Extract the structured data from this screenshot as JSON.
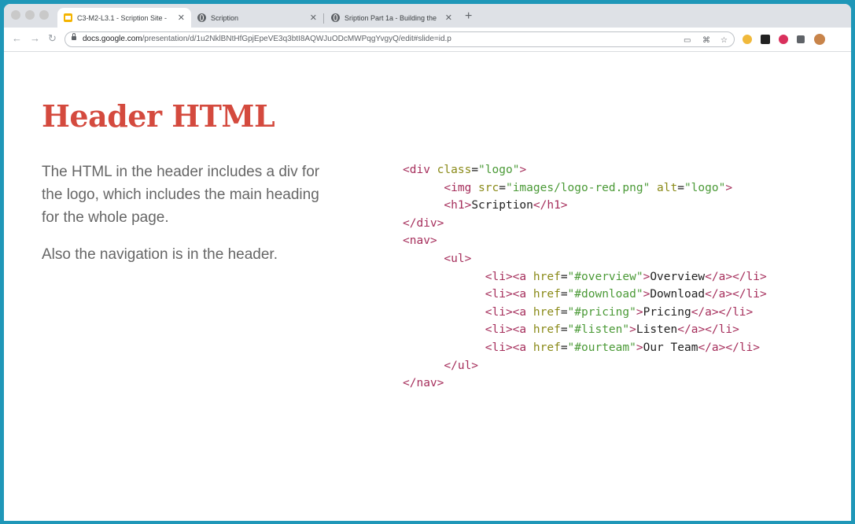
{
  "browser": {
    "tabs": [
      {
        "title": "C3-M2-L3.1 - Scription Site - ",
        "close": "✕",
        "icon": "google-slides-icon",
        "active": true
      },
      {
        "title": "Scription",
        "close": "✕",
        "icon": "globe-icon",
        "active": false
      },
      {
        "title": "Sription Part 1a - Building the ",
        "close": "✕",
        "icon": "globe-icon",
        "active": false
      }
    ],
    "new_tab": "+",
    "nav": {
      "back": "←",
      "forward": "→",
      "reload": "↻"
    },
    "url": {
      "domain": "docs.google.com",
      "path": "/presentation/d/1u2NklBNtHfGpjEpeVE3q3btI8AQWJuODcMWPqgYvgyQ/edit#slide=id.p"
    },
    "omnibox_icons": {
      "cast": "▭",
      "apps": "⌘",
      "bookmark": "☆"
    },
    "extension_colors": [
      "#f0b93b",
      "#222222",
      "#d9305c",
      "#5f6368",
      "#c8844a"
    ],
    "window_background": "#1f97b8"
  },
  "slide": {
    "title": "Header HTML",
    "title_color": "#d44a3e",
    "paragraphs": [
      "The HTML in the header includes a div for the logo, which includes the main heading for the whole page.",
      "Also the navigation is in the header."
    ],
    "code_lines": [
      {
        "indent": "",
        "segments": [
          [
            "t",
            "<div"
          ],
          [
            "a",
            " class"
          ],
          [
            "p",
            "="
          ],
          [
            "v",
            "\"logo\""
          ],
          [
            "t",
            ">"
          ]
        ]
      },
      {
        "indent": "      ",
        "segments": [
          [
            "t",
            "<img"
          ],
          [
            "a",
            " src"
          ],
          [
            "p",
            "="
          ],
          [
            "v",
            "\"images/logo-red.png\""
          ],
          [
            "a",
            " alt"
          ],
          [
            "p",
            "="
          ],
          [
            "v",
            "\"logo\""
          ],
          [
            "t",
            ">"
          ]
        ]
      },
      {
        "indent": "      ",
        "segments": [
          [
            "t",
            "<h1>"
          ],
          [
            "p",
            "Scription"
          ],
          [
            "t",
            "</h1>"
          ]
        ]
      },
      {
        "indent": "",
        "segments": [
          [
            "t",
            "</div>"
          ]
        ]
      },
      {
        "indent": "",
        "segments": [
          [
            "t",
            "<nav>"
          ]
        ]
      },
      {
        "indent": "      ",
        "segments": [
          [
            "t",
            "<ul>"
          ]
        ]
      },
      {
        "indent": "            ",
        "segments": [
          [
            "t",
            "<li><a"
          ],
          [
            "a",
            " href"
          ],
          [
            "p",
            "="
          ],
          [
            "v",
            "\"#overview\""
          ],
          [
            "t",
            ">"
          ],
          [
            "p",
            "Overview"
          ],
          [
            "t",
            "</a></li>"
          ]
        ]
      },
      {
        "indent": "            ",
        "segments": [
          [
            "t",
            "<li><a"
          ],
          [
            "a",
            " href"
          ],
          [
            "p",
            "="
          ],
          [
            "v",
            "\"#download\""
          ],
          [
            "t",
            ">"
          ],
          [
            "p",
            "Download"
          ],
          [
            "t",
            "</a></li>"
          ]
        ]
      },
      {
        "indent": "            ",
        "segments": [
          [
            "t",
            "<li><a"
          ],
          [
            "a",
            " href"
          ],
          [
            "p",
            "="
          ],
          [
            "v",
            "\"#pricing\""
          ],
          [
            "t",
            ">"
          ],
          [
            "p",
            "Pricing"
          ],
          [
            "t",
            "</a></li>"
          ]
        ]
      },
      {
        "indent": "            ",
        "segments": [
          [
            "t",
            "<li><a"
          ],
          [
            "a",
            " href"
          ],
          [
            "p",
            "="
          ],
          [
            "v",
            "\"#listen\""
          ],
          [
            "t",
            ">"
          ],
          [
            "p",
            "Listen"
          ],
          [
            "t",
            "</a></li>"
          ]
        ]
      },
      {
        "indent": "            ",
        "segments": [
          [
            "t",
            "<li><a"
          ],
          [
            "a",
            " href"
          ],
          [
            "p",
            "="
          ],
          [
            "v",
            "\"#ourteam\""
          ],
          [
            "t",
            ">"
          ],
          [
            "p",
            "Our Team"
          ],
          [
            "t",
            "</a></li>"
          ]
        ]
      },
      {
        "indent": "      ",
        "segments": [
          [
            "t",
            "</ul>"
          ]
        ]
      },
      {
        "indent": "",
        "segments": [
          [
            "t",
            "</nav>"
          ]
        ]
      }
    ]
  }
}
